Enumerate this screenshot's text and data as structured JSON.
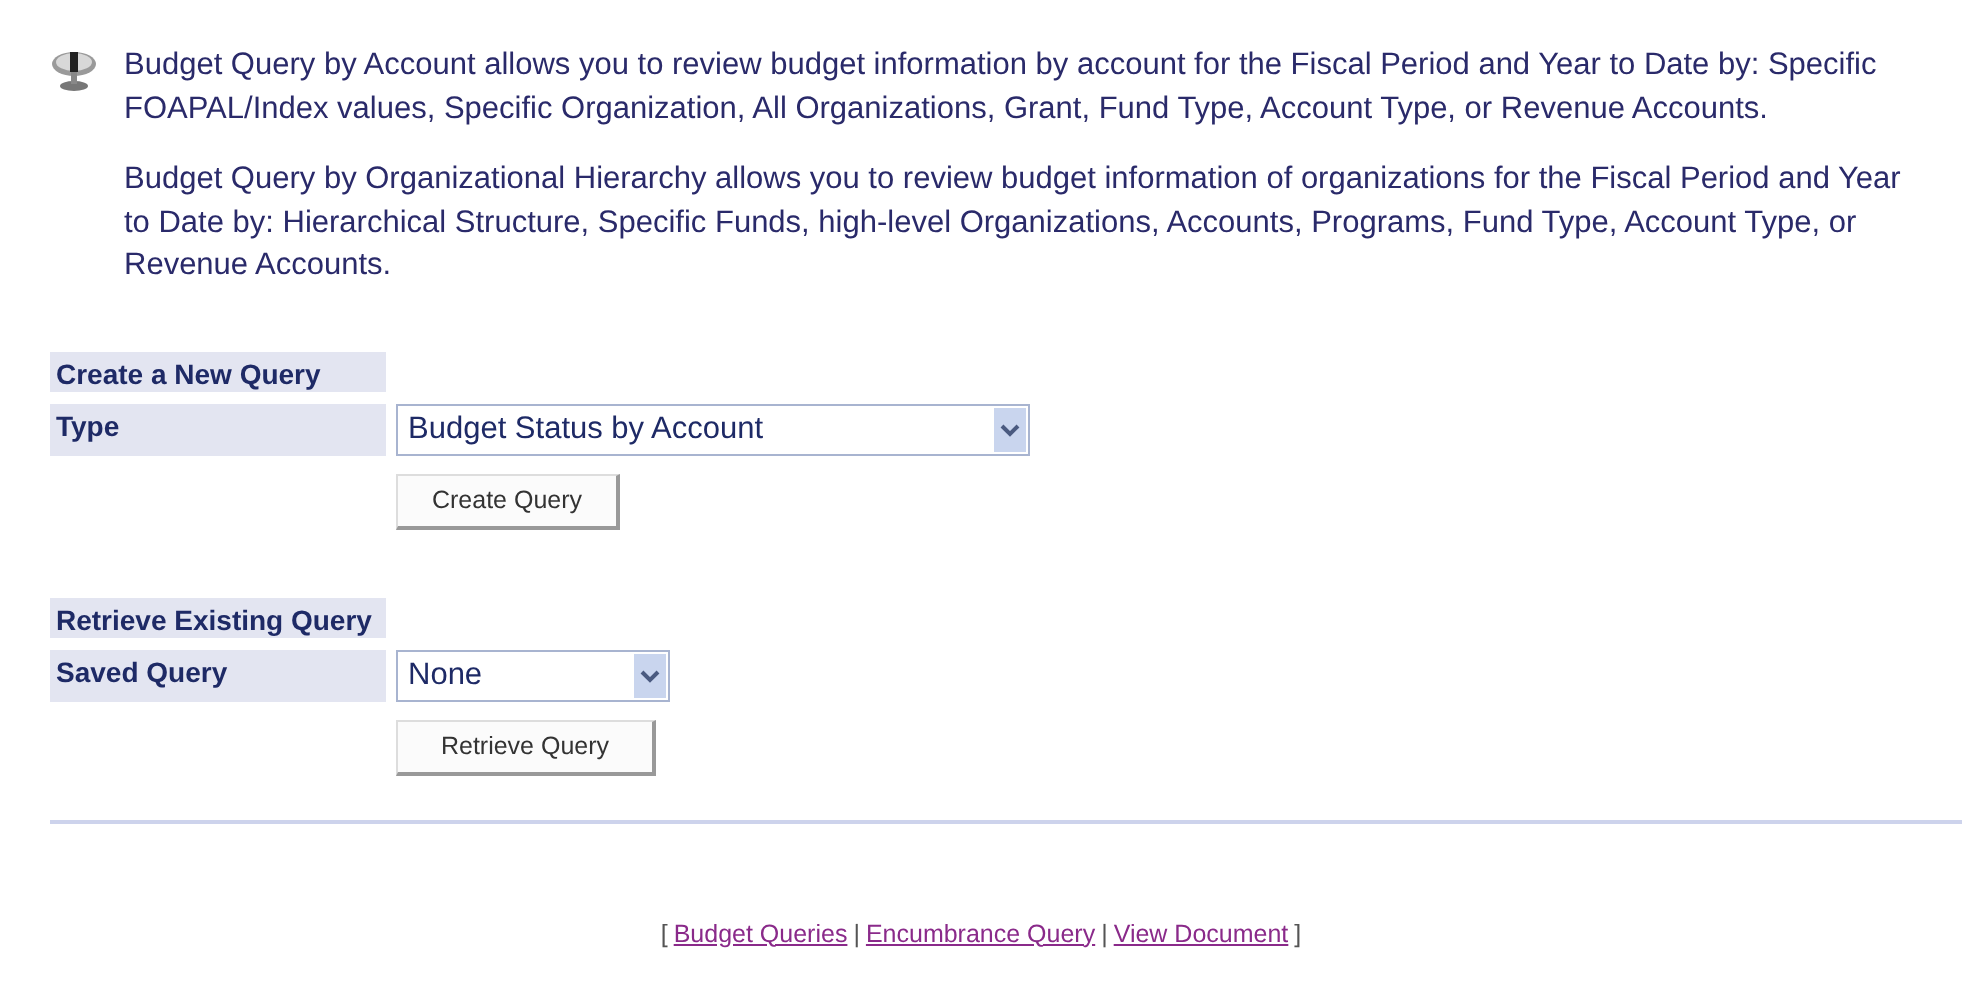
{
  "intro": {
    "paragraphs": [
      "Budget Query by Account allows you to review budget information by account for the Fiscal Period and Year to Date by: Specific FOAPAL/Index values, Specific Organization, All Organizations, Grant, Fund Type, Account Type, or Revenue Accounts.",
      "Budget Query by Organizational Hierarchy allows you to review budget information of organizations for the Fiscal Period and Year to Date by: Hierarchical Structure, Specific Funds, high-level Organizations, Accounts, Programs, Fund Type, Account Type, or Revenue Accounts."
    ]
  },
  "sections": [
    {
      "heading": "Create a New Query",
      "field_label": "Type",
      "select_value": "Budget Status by Account",
      "button": "Create Query"
    },
    {
      "heading": "Retrieve Existing Query",
      "field_label": "Saved Query",
      "select_value": "None",
      "button": "Retrieve Query"
    }
  ],
  "footer": {
    "open": "[",
    "links": [
      "Budget Queries",
      "Encumbrance Query",
      "View Document"
    ],
    "separator": "|",
    "close": "]"
  }
}
